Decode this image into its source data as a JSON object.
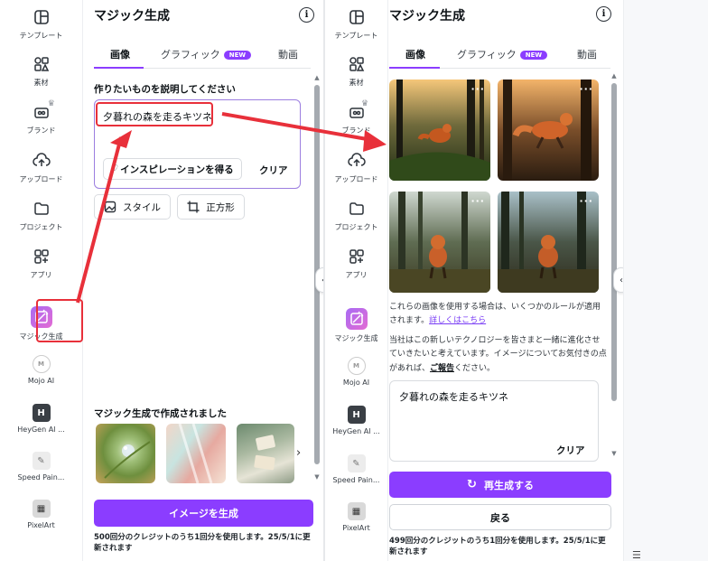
{
  "rail_items": [
    {
      "label": "テンプレート",
      "icon": "template-icon"
    },
    {
      "label": "素材",
      "icon": "elements-icon"
    },
    {
      "label": "ブランド",
      "icon": "brand-icon"
    },
    {
      "label": "アップロード",
      "icon": "upload-icon"
    },
    {
      "label": "プロジェクト",
      "icon": "folder-icon"
    },
    {
      "label": "アプリ",
      "icon": "apps-icon"
    },
    {
      "label": "マジック生成",
      "icon": "magic-generate-icon"
    },
    {
      "label": "Mojo AI",
      "icon": "mojo-ai-icon"
    },
    {
      "label": "HeyGen AI ...",
      "icon": "heygen-icon"
    },
    {
      "label": "Speed Pain...",
      "icon": "speed-paint-icon"
    },
    {
      "label": "PixelArt",
      "icon": "pixelart-icon"
    }
  ],
  "panel": {
    "title": "マジック生成",
    "tabs": [
      {
        "label": "画像"
      },
      {
        "label": "グラフィック",
        "badge": "NEW"
      },
      {
        "label": "動画"
      }
    ]
  },
  "left": {
    "prompt_label": "作りたいものを説明してください",
    "prompt_value": "夕暮れの森を走るキツネ",
    "inspire_label": "インスピレーションを得る",
    "clear_label": "クリア",
    "style_label": "スタイル",
    "ratio_label": "正方形",
    "made_with_label": "マジック生成で作成されました",
    "generate_label": "イメージを生成",
    "credit_text": "500回分のクレジットのうち1回分を使用します。25/5/1に更新されます"
  },
  "right": {
    "notice_text": "これらの画像を使用する場合は、いくつかのルールが適用されます。",
    "notice_link": "詳しくはこちら",
    "feedback_pre": "当社はこの新しいテクノロジーを皆さまと一緒に進化させていきたいと考えています。イメージについてお気付きの点があれば、",
    "feedback_link": "ご報告",
    "feedback_post": "ください。",
    "prompt_value": "夕暮れの森を走るキツネ",
    "clear_label": "クリア",
    "regen_label": "再生成する",
    "back_label": "戻る",
    "credit_text": "499回分のクレジットのうち1回分を使用します。25/5/1に更新されます"
  },
  "colors": {
    "accent": "#8b3dff",
    "annotation_red": "#e8303a"
  }
}
